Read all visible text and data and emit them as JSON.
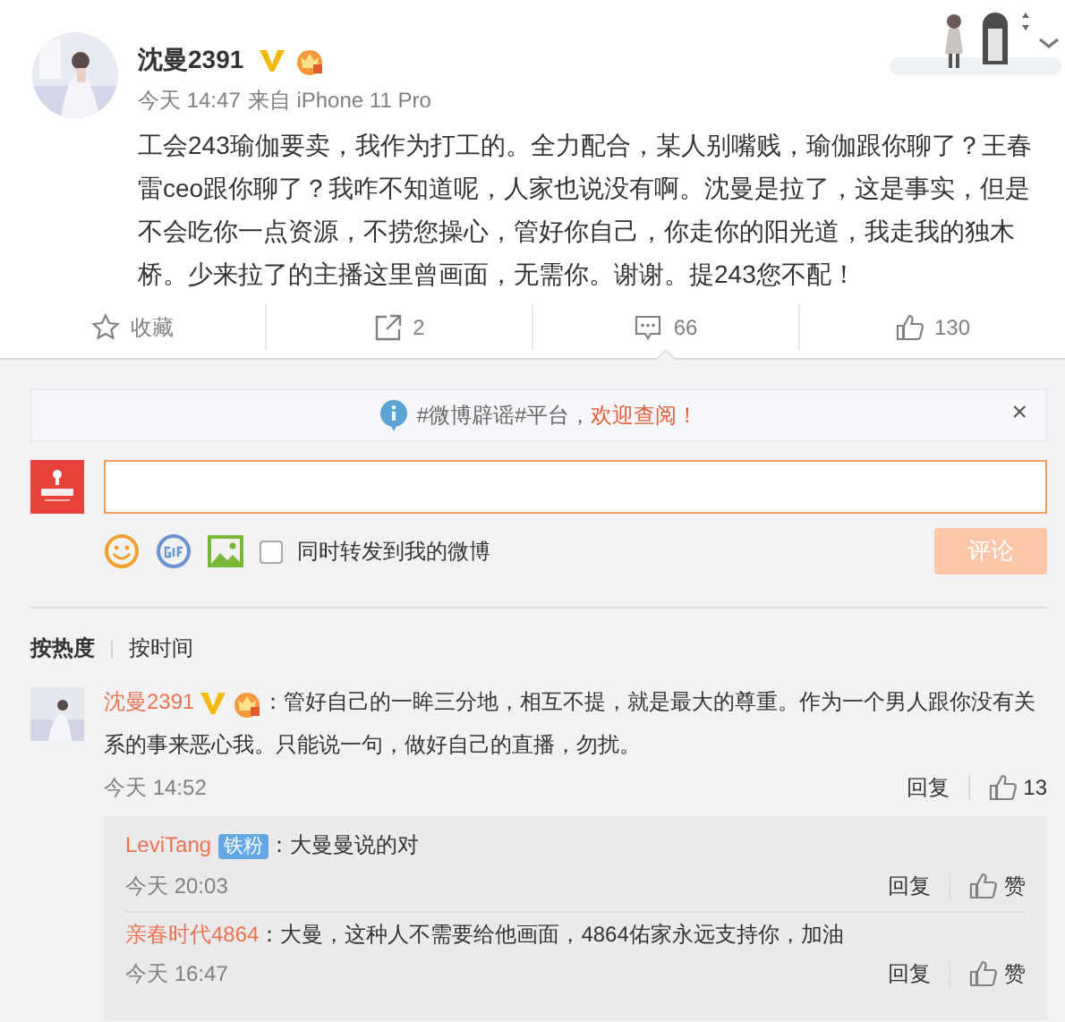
{
  "post": {
    "author": "沈曼2391",
    "verified": true,
    "vip": true,
    "time": "今天 14:47",
    "source": "来自 iPhone 11 Pro",
    "text": "工会243瑜伽要卖，我作为打工的。全力配合，某人别嘴贱，瑜伽跟你聊了？王春雷ceo跟你聊了？我咋不知道呢，人家也说没有啊。沈曼是拉了，这是事实，但是不会吃你一点资源，不捞您操心，管好你自己，你走你的阳光道，我走我的独木桥。少来拉了的主播这里曾画面，无需你。谢谢。提243您不配！"
  },
  "actions": [
    {
      "kind": "favorite",
      "label": "收藏",
      "selected": false
    },
    {
      "kind": "repost",
      "label": "2",
      "selected": false
    },
    {
      "kind": "comment",
      "label": "66",
      "selected": true
    },
    {
      "kind": "like",
      "label": "130",
      "selected": false
    }
  ],
  "notice": {
    "text": "#微博辟谣#平台，",
    "link": "欢迎查阅！",
    "close": "×"
  },
  "composer": {
    "share_label": "同时转发到我的微博",
    "share_checked": false,
    "submit": "评论",
    "submit_disabled": true
  },
  "sort_tabs": [
    {
      "label": "按热度",
      "selected": true
    },
    {
      "label": "按时间",
      "selected": false
    }
  ],
  "comments": [
    {
      "author": "沈曼2391",
      "verified": true,
      "vip": true,
      "text": "：管好自己的一眸三分地，相互不提，就是最大的尊重。作为一个男人跟你没有关系的事来恶心我。只能说一句，做好自己的直播，勿扰。",
      "time": "今天 14:52",
      "reply": "回复",
      "likes": "13",
      "replies": [
        {
          "author": "LeviTang",
          "badge": "铁粉",
          "text": "：大曼曼说的对",
          "time": "今天 20:03",
          "reply": "回复",
          "likes": "赞"
        },
        {
          "author": "亲春时代4864",
          "text": "：大曼，这种人不需要给他画面，4864佑家永远支持你，加油",
          "time": "今天 16:47",
          "reply": "回复",
          "likes": "赞"
        }
      ]
    }
  ]
}
